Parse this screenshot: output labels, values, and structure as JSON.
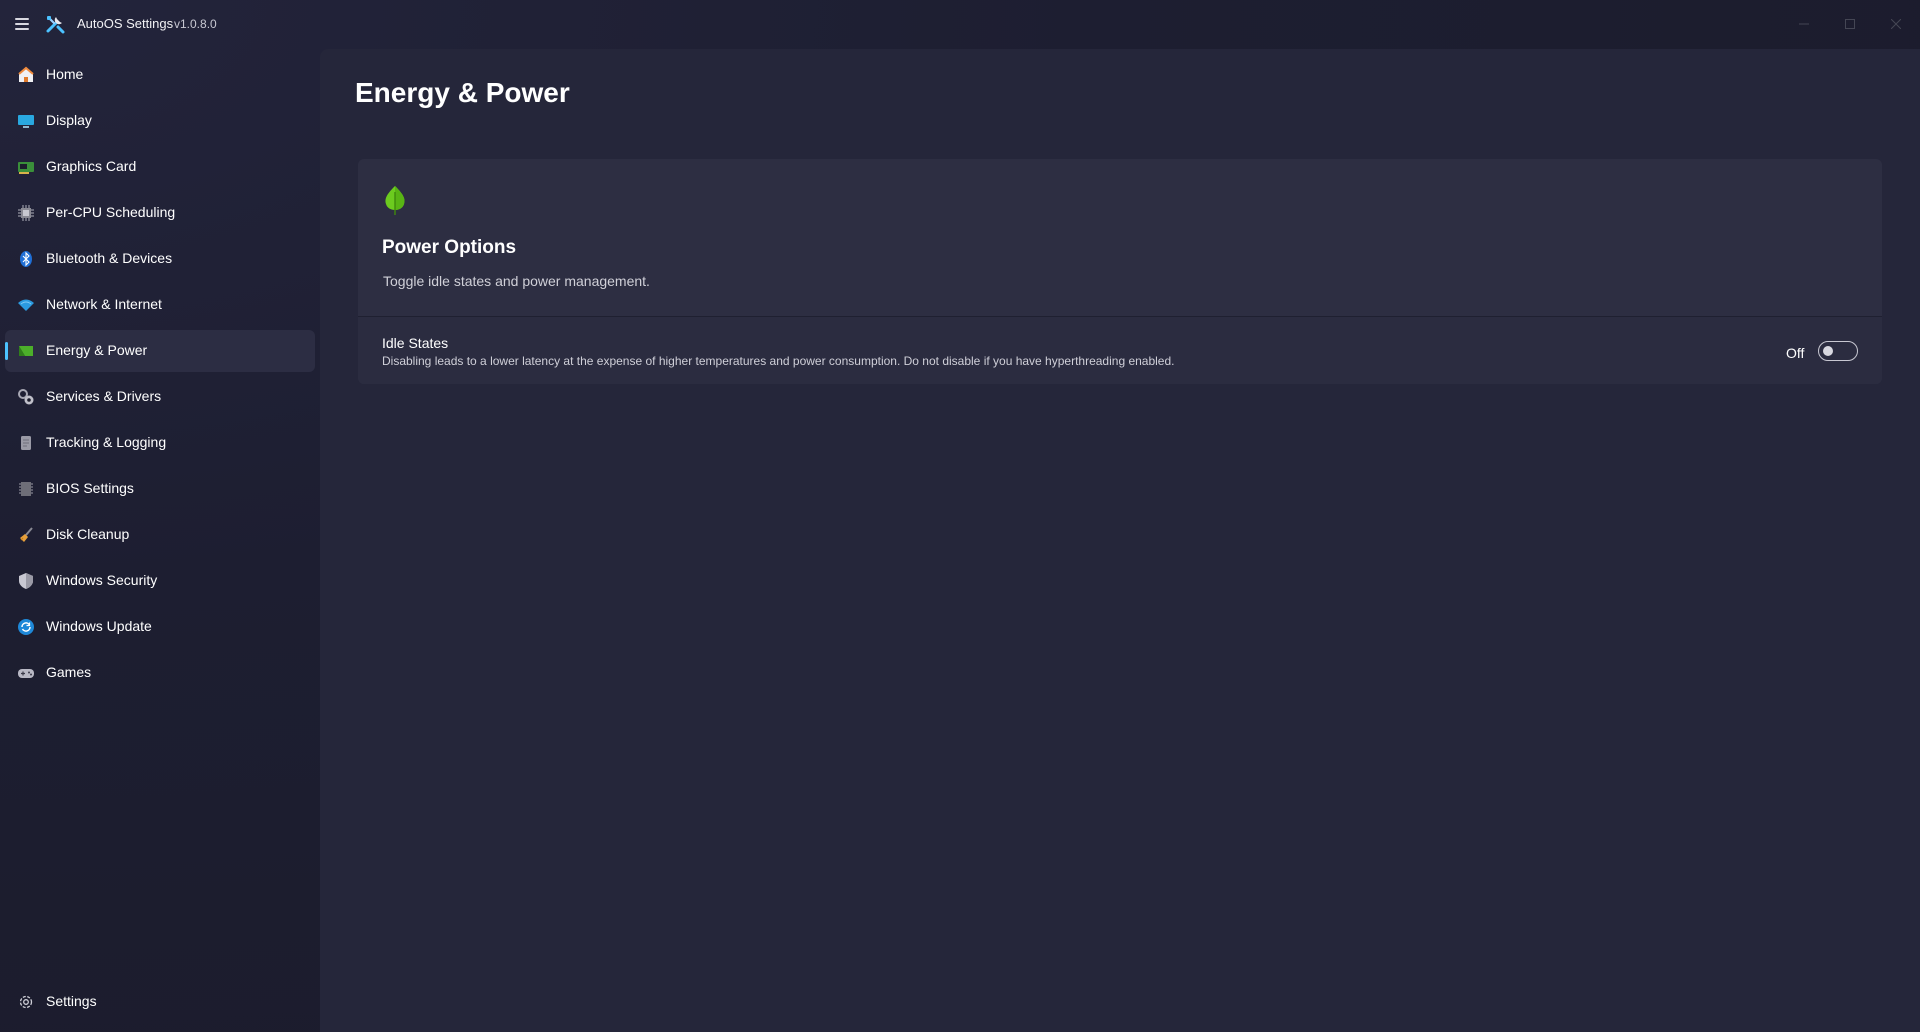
{
  "window": {
    "title": "AutoOS Settings",
    "version": "v1.0.8.0"
  },
  "sidebar": {
    "items": [
      {
        "label": "Home",
        "icon": "home-icon"
      },
      {
        "label": "Display",
        "icon": "monitor-icon"
      },
      {
        "label": "Graphics Card",
        "icon": "graphics-card-icon"
      },
      {
        "label": "Per-CPU Scheduling",
        "icon": "cpu-chip-icon"
      },
      {
        "label": "Bluetooth & Devices",
        "icon": "bluetooth-icon"
      },
      {
        "label": "Network & Internet",
        "icon": "wifi-icon"
      },
      {
        "label": "Energy & Power",
        "icon": "battery-icon",
        "active": true
      },
      {
        "label": "Services & Drivers",
        "icon": "gears-icon"
      },
      {
        "label": "Tracking & Logging",
        "icon": "document-icon"
      },
      {
        "label": "BIOS Settings",
        "icon": "bios-chip-icon"
      },
      {
        "label": "Disk Cleanup",
        "icon": "broom-icon"
      },
      {
        "label": "Windows Security",
        "icon": "shield-icon"
      },
      {
        "label": "Windows Update",
        "icon": "update-icon"
      },
      {
        "label": "Games",
        "icon": "gamepad-icon"
      }
    ],
    "footer": {
      "label": "Settings",
      "icon": "gear-icon"
    }
  },
  "page": {
    "title": "Energy & Power"
  },
  "power_options": {
    "icon": "leaf-icon",
    "title": "Power Options",
    "description": "Toggle idle states and power management.",
    "settings": [
      {
        "title": "Idle States",
        "description": "Disabling leads to a lower latency at the expense of higher temperatures and power consumption. Do not disable if you have hyperthreading enabled.",
        "state_label": "Off",
        "enabled": false
      }
    ]
  },
  "colors": {
    "accent": "#4cc2ff",
    "leaf": "#6ccb1f"
  }
}
